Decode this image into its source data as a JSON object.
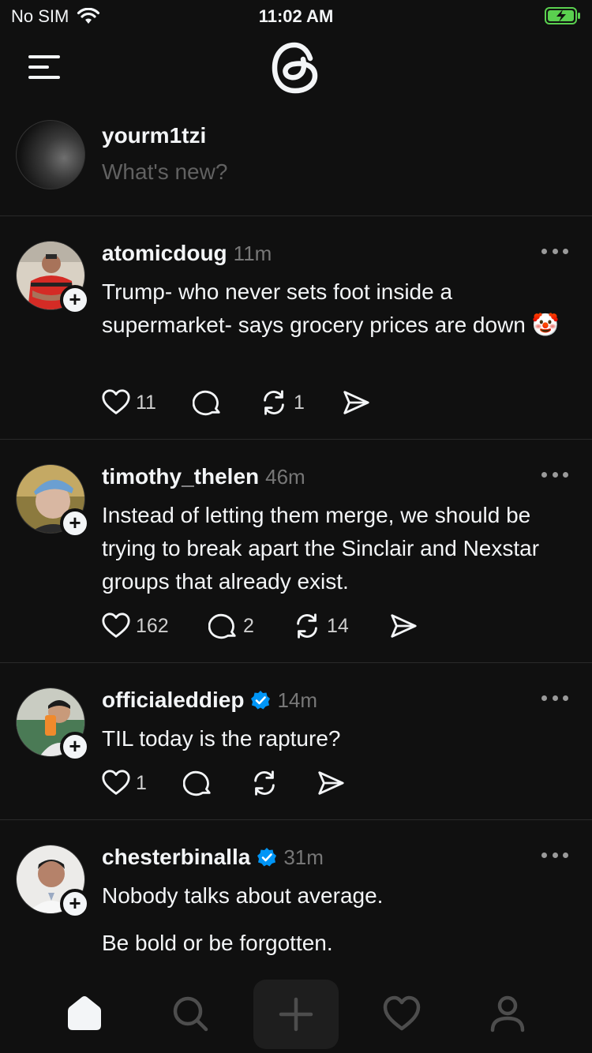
{
  "status_bar": {
    "carrier": "No SIM",
    "time": "11:02 AM"
  },
  "composer": {
    "username": "yourm1tzi",
    "placeholder": "What's new?"
  },
  "posts": [
    {
      "username": "atomicdoug",
      "time": "11m",
      "verified": false,
      "body": [
        "Trump- who never sets foot inside a supermarket- says grocery prices are down 🤡"
      ],
      "likes": "11",
      "replies": "",
      "reposts": "1"
    },
    {
      "username": "timothy_thelen",
      "time": "46m",
      "verified": false,
      "body": [
        "Instead of letting them merge, we should be trying to break apart the Sinclair and Nexstar groups that already exist."
      ],
      "likes": "162",
      "replies": "2",
      "reposts": "14"
    },
    {
      "username": "officialeddiep",
      "time": "14m",
      "verified": true,
      "body": [
        "TIL today is the rapture?"
      ],
      "likes": "1",
      "replies": "",
      "reposts": ""
    },
    {
      "username": "chesterbinalla",
      "time": "31m",
      "verified": true,
      "body": [
        "Nobody talks about average.",
        "Be bold or be forgotten."
      ]
    }
  ],
  "colors": {
    "background": "#101010",
    "text": "#f3f5f7",
    "muted": "#777777",
    "verified": "#0095f6"
  },
  "tab_bar": {
    "items": [
      "home-icon",
      "search-icon",
      "create-icon",
      "activity-icon",
      "profile-icon"
    ]
  }
}
